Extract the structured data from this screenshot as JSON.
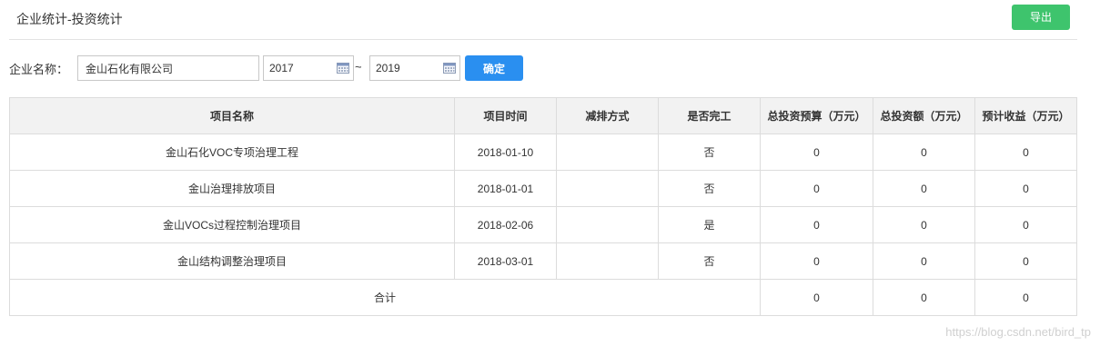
{
  "header": {
    "title": "企业统计-投资统计",
    "export_label": "导出"
  },
  "filter": {
    "company_label": "企业名称：",
    "company_value": "金山石化有限公司",
    "start_year": "2017",
    "separator": "~",
    "end_year": "2019",
    "confirm_label": "确定"
  },
  "table": {
    "columns": [
      "项目名称",
      "项目时间",
      "减排方式",
      "是否完工",
      "总投资预算（万元）",
      "总投资额（万元）",
      "预计收益（万元）"
    ],
    "rows": [
      {
        "name": "金山石化VOC专项治理工程",
        "date": "2018-01-10",
        "method": "",
        "completed": "否",
        "budget": "0",
        "invested": "0",
        "revenue": "0"
      },
      {
        "name": "金山治理排放项目",
        "date": "2018-01-01",
        "method": "",
        "completed": "否",
        "budget": "0",
        "invested": "0",
        "revenue": "0"
      },
      {
        "name": "金山VOCs过程控制治理项目",
        "date": "2018-02-06",
        "method": "",
        "completed": "是",
        "budget": "0",
        "invested": "0",
        "revenue": "0"
      },
      {
        "name": "金山结构调整治理项目",
        "date": "2018-03-01",
        "method": "",
        "completed": "否",
        "budget": "0",
        "invested": "0",
        "revenue": "0"
      }
    ],
    "total": {
      "label": "合计",
      "budget": "0",
      "invested": "0",
      "revenue": "0"
    }
  },
  "watermark": "https://blog.csdn.net/bird_tp",
  "colors": {
    "export": "#3ec46d",
    "confirm": "#2a8ff0",
    "header_bg": "#f2f2f2",
    "border": "#dcdcdc"
  }
}
